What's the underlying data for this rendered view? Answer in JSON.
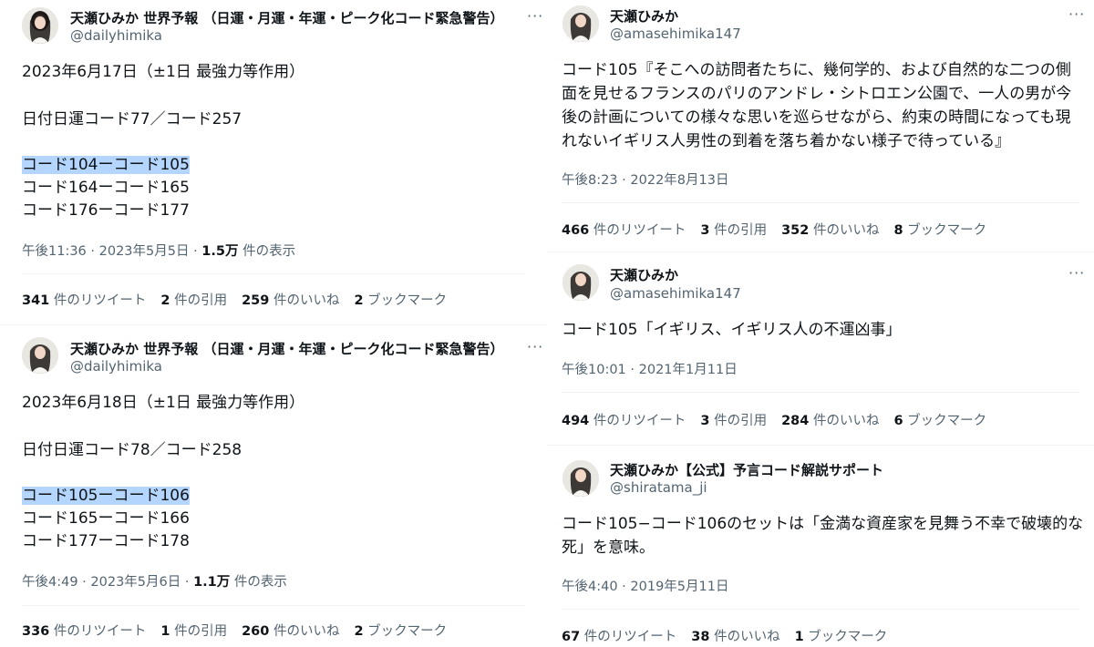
{
  "tweets": [
    {
      "display_name": "天瀬ひみか 世界予報 （日運・月運・年運・ピーク化コード緊急警告）",
      "handle": "@dailyhimika",
      "lines": [
        "2023年6月17日（±1日 最強力等作用）",
        "日付日運コード77／コード257",
        "コード104ーコード105",
        "コード164ーコード165",
        "コード176ーコード177"
      ],
      "time": "午後11:36 · 2023年5月5日 · ",
      "views_count": "1.5万",
      "views_label": " 件の表示",
      "stats": {
        "retweets": "341",
        "retweets_label": " 件のリツイート",
        "quotes": "2",
        "quotes_label": " 件の引用",
        "likes": "259",
        "likes_label": " 件のいいね",
        "bookmarks": "2",
        "bookmarks_label": " ブックマーク"
      }
    },
    {
      "display_name": "天瀬ひみか 世界予報 （日運・月運・年運・ピーク化コード緊急警告）",
      "handle": "@dailyhimika",
      "lines": [
        "2023年6月18日（±1日 最強力等作用）",
        "日付日運コード78／コード258",
        "コード105ーコード106",
        "コード165ーコード166",
        "コード177ーコード178"
      ],
      "time": "午後4:49 · 2023年5月6日 · ",
      "views_count": "1.1万",
      "views_label": " 件の表示",
      "stats": {
        "retweets": "336",
        "retweets_label": " 件のリツイート",
        "quotes": "1",
        "quotes_label": " 件の引用",
        "likes": "260",
        "likes_label": " 件のいいね",
        "bookmarks": "2",
        "bookmarks_label": " ブックマーク"
      }
    },
    {
      "display_name": "天瀬ひみか",
      "handle": "@amasehimika147",
      "lines": [
        "コード105『そこへの訪問者たちに、幾何学的、および自然的な二つの側",
        "面を見せるフランスのパリのアンドレ・シトロエン公園で、一人の男が今",
        "後の計画についての様々な思いを巡らせながら、約束の時間になっても現",
        "れないイギリス人男性の到着を落ち着かない様子で待っている』"
      ],
      "time": "午後8:23 · 2022年8月13日",
      "stats": {
        "retweets": "466",
        "retweets_label": " 件のリツイート",
        "quotes": "3",
        "quotes_label": " 件の引用",
        "likes": "352",
        "likes_label": " 件のいいね",
        "bookmarks": "8",
        "bookmarks_label": " ブックマーク"
      }
    },
    {
      "display_name": "天瀬ひみか",
      "handle": "@amasehimika147",
      "lines": [
        "コード105「イギリス、イギリス人の不運凶事」"
      ],
      "time": "午後10:01 · 2021年1月11日",
      "stats": {
        "retweets": "494",
        "retweets_label": " 件のリツイート",
        "quotes": "3",
        "quotes_label": " 件の引用",
        "likes": "284",
        "likes_label": " 件のいいね",
        "bookmarks": "6",
        "bookmarks_label": " ブックマーク"
      }
    },
    {
      "display_name": "天瀬ひみか【公式】予言コード解説サポート",
      "handle": "@shiratama_ji",
      "lines": [
        "コード105−コード106のセットは「金満な資産家を見舞う不幸で破壊的な",
        "死」を意味。"
      ],
      "time": "午後4:40 · 2019年5月11日",
      "stats": {
        "retweets": "67",
        "retweets_label": " 件のリツイート",
        "likes": "38",
        "likes_label": " 件のいいね",
        "bookmarks": "1",
        "bookmarks_label": " ブックマーク"
      }
    }
  ],
  "more_glyph": "···",
  "colors": {
    "text": "#0f1419",
    "secondary": "#536471",
    "highlight": "#b4d5fe",
    "divider": "#eff3f4"
  }
}
